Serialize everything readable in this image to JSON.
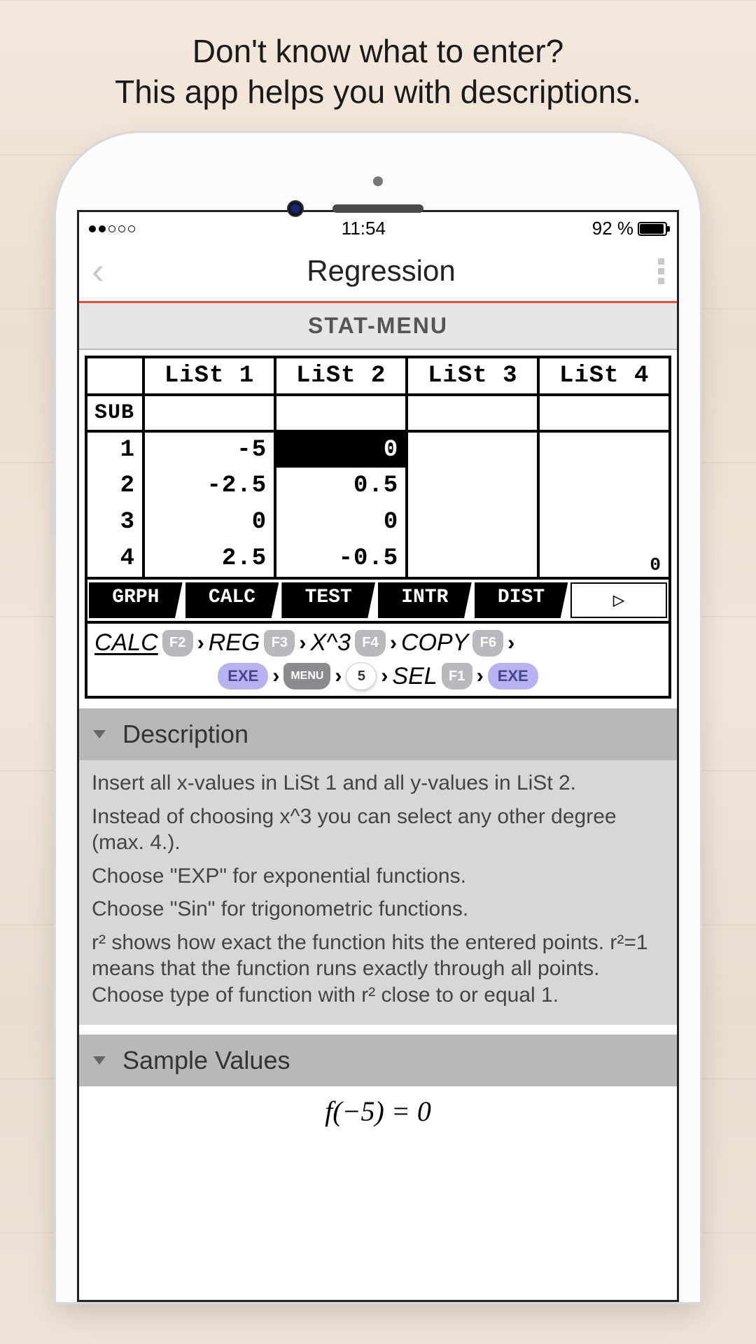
{
  "promo": {
    "line1": "Don't know what to enter?",
    "line2": "This app helps you with descriptions."
  },
  "status": {
    "time": "11:54",
    "battery_pct": "92 %"
  },
  "nav": {
    "title": "Regression"
  },
  "stat_menu": "STAT-MENU",
  "calc": {
    "headers": [
      "",
      "LiSt 1",
      "LiSt 2",
      "LiSt 3",
      "LiSt 4"
    ],
    "sub_label": "SUB",
    "rows": [
      {
        "idx": "1",
        "c1": "-5",
        "c2": "0",
        "c3": "",
        "c4": "",
        "sel": 2
      },
      {
        "idx": "2",
        "c1": "-2.5",
        "c2": "0.5",
        "c3": "",
        "c4": ""
      },
      {
        "idx": "3",
        "c1": "0",
        "c2": "0",
        "c3": "",
        "c4": ""
      },
      {
        "idx": "4",
        "c1": "2.5",
        "c2": "-0.5",
        "c3": "",
        "c4": ""
      }
    ],
    "softkeys": [
      "GRPH",
      "CALC",
      "TEST",
      "INTR",
      "DIST",
      "▷"
    ],
    "cursor_value": "0"
  },
  "path": {
    "row1": [
      {
        "t": "CALC",
        "kind": "label",
        "underline": true
      },
      {
        "t": "F2",
        "kind": "fkey"
      },
      {
        "t": "REG",
        "kind": "label"
      },
      {
        "t": "F3",
        "kind": "fkey"
      },
      {
        "t": "X^3",
        "kind": "label"
      },
      {
        "t": "F4",
        "kind": "fkey"
      },
      {
        "t": "COPY",
        "kind": "label"
      },
      {
        "t": "F6",
        "kind": "fkey"
      }
    ],
    "row2": [
      {
        "t": "EXE",
        "kind": "exe"
      },
      {
        "t": "MENU",
        "kind": "menu"
      },
      {
        "t": "5",
        "kind": "num"
      },
      {
        "t": "SEL",
        "kind": "label"
      },
      {
        "t": "F1",
        "kind": "fkey"
      },
      {
        "t": "EXE",
        "kind": "exe"
      }
    ]
  },
  "sections": {
    "description": {
      "title": "Description",
      "paras": [
        "Insert all x-values in LiSt 1 and all y-values in LiSt 2.",
        "Instead of choosing x^3 you can select any other degree (max. 4.).",
        "Choose \"EXP\" for exponential functions.",
        "Choose \"Sin\" for trigonometric functions.",
        "r² shows how exact the function hits the entered points. r²=1 means that the function runs exactly through all points. Choose type of function with r² close to or equal 1."
      ]
    },
    "sample": {
      "title": "Sample Values",
      "formula": "f(−5) = 0"
    }
  }
}
